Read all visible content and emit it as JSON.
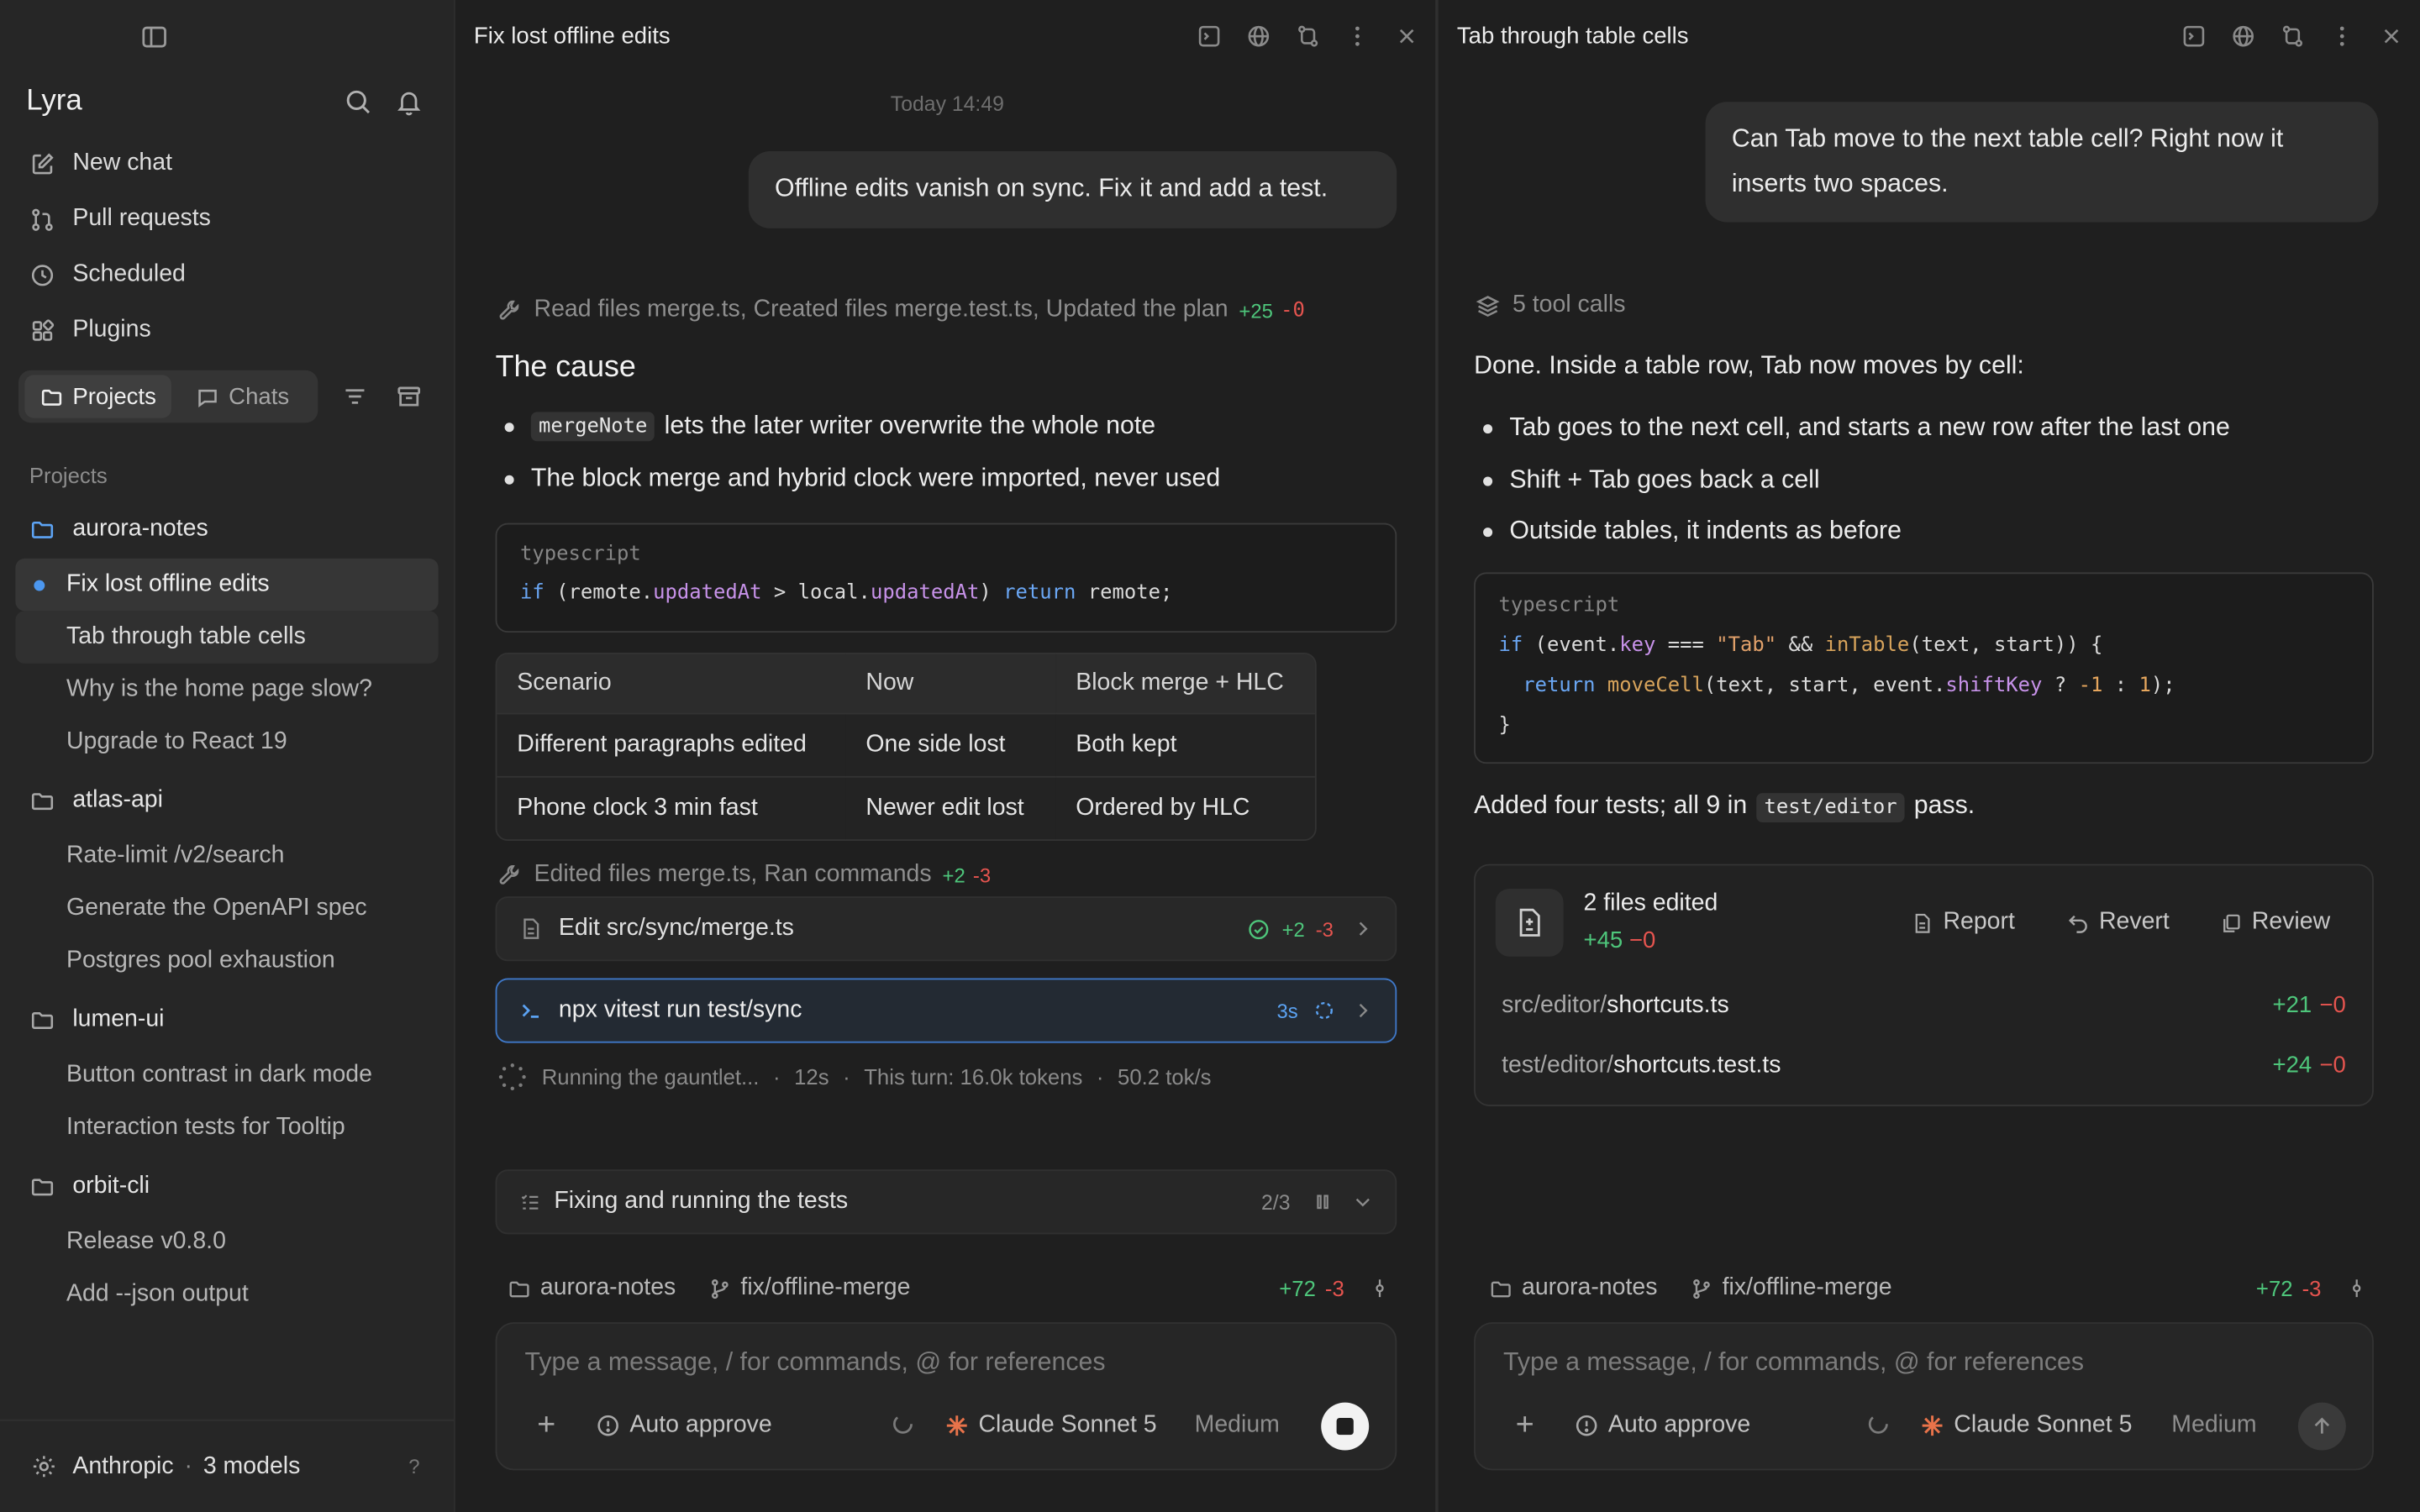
{
  "sidebar": {
    "brand": "Lyra",
    "nav": [
      {
        "label": "New chat",
        "icon": "edit-icon"
      },
      {
        "label": "Pull requests",
        "icon": "pull-request-icon"
      },
      {
        "label": "Scheduled",
        "icon": "clock-icon"
      },
      {
        "label": "Plugins",
        "icon": "grid-icon"
      }
    ],
    "tabs": [
      "Projects",
      "Chats"
    ],
    "projects_label": "Projects",
    "projects": [
      {
        "name": "aurora-notes",
        "threads": [
          "Fix lost offline edits",
          "Tab through table cells",
          "Why is the home page slow?",
          "Upgrade to React 19"
        ]
      },
      {
        "name": "atlas-api",
        "threads": [
          "Rate-limit /v2/search",
          "Generate the OpenAPI spec",
          "Postgres pool exhaustion"
        ]
      },
      {
        "name": "lumen-ui",
        "threads": [
          "Button contrast in dark mode",
          "Interaction tests for Tooltip"
        ]
      },
      {
        "name": "orbit-cli",
        "threads": [
          "Release v0.8.0",
          "Add --json output"
        ]
      }
    ],
    "footer": {
      "provider": "Anthropic",
      "models": "3 models",
      "help": "?"
    }
  },
  "pane1": {
    "title": "Fix lost offline edits",
    "timestamp": "Today 14:49",
    "user_message": "Offline edits vanish on sync. Fix it and add a test.",
    "tool_summary": {
      "text": "Read files merge.ts, Created files merge.test.ts, Updated the plan",
      "add": "+25",
      "del": "-0"
    },
    "heading": "The cause",
    "bullets": [
      {
        "code": "mergeNote",
        "text": "lets the later writer overwrite the whole note"
      },
      {
        "text": "The block merge and hybrid clock were imported, never used"
      }
    ],
    "code_lang": "typescript",
    "table": {
      "headers": [
        "Scenario",
        "Now",
        "Block merge + HLC"
      ],
      "rows": [
        [
          "Different paragraphs edited",
          "One side lost",
          "Both kept"
        ],
        [
          "Phone clock 3 min fast",
          "Newer edit lost",
          "Ordered by HLC"
        ]
      ]
    },
    "tool_summary2": {
      "text": "Edited files merge.ts, Ran commands",
      "add": "+2",
      "del": "-3"
    },
    "edit_row": {
      "label": "Edit src/sync/merge.ts",
      "add": "+2",
      "del": "-3"
    },
    "run_row": {
      "label": "npx vitest run test/sync",
      "time": "3s"
    },
    "status": {
      "text": "Running the gauntlet...",
      "elapsed": "12s",
      "tokens": "This turn: 16.0k tokens",
      "rate": "50.2 tok/s"
    },
    "plan": {
      "label": "Fixing and running the tests",
      "progress": "2/3"
    },
    "context": {
      "project": "aurora-notes",
      "branch": "fix/offline-merge",
      "add": "+72",
      "del": "-3"
    },
    "composer": {
      "placeholder": "Type a message, / for commands, @ for references",
      "auto_approve": "Auto approve",
      "model": "Claude Sonnet 5",
      "effort": "Medium"
    }
  },
  "pane2": {
    "title": "Tab through table cells",
    "user_message": "Can Tab move to the next table cell? Right now it inserts two spaces.",
    "tool_calls": "5 tool calls",
    "intro": "Done. Inside a table row, Tab now moves by cell:",
    "bullets": [
      "Tab goes to the next cell, and starts a new row after the last one",
      "Shift + Tab goes back a cell",
      "Outside tables, it indents as before"
    ],
    "code_lang": "typescript",
    "result": {
      "before": "Added four tests; all 9 in",
      "code": "test/editor",
      "after": "pass."
    },
    "files_card": {
      "title": "2 files edited",
      "add": "+45",
      "del": "−0",
      "buttons": [
        "Report",
        "Revert",
        "Review"
      ],
      "files": [
        {
          "dir": "src/editor/",
          "name": "shortcuts.ts",
          "add": "+21",
          "del": "−0"
        },
        {
          "dir": "test/editor/",
          "name": "shortcuts.test.ts",
          "add": "+24",
          "del": "−0"
        }
      ]
    },
    "context": {
      "project": "aurora-notes",
      "branch": "fix/offline-merge",
      "add": "+72",
      "del": "-3"
    },
    "composer": {
      "placeholder": "Type a message, / for commands, @ for references",
      "auto_approve": "Auto approve",
      "model": "Claude Sonnet 5",
      "effort": "Medium"
    }
  },
  "colors": {
    "accent": "#4c97ef",
    "added": "#4ec67b",
    "removed": "#e5544f",
    "spark": "#e8734a"
  }
}
